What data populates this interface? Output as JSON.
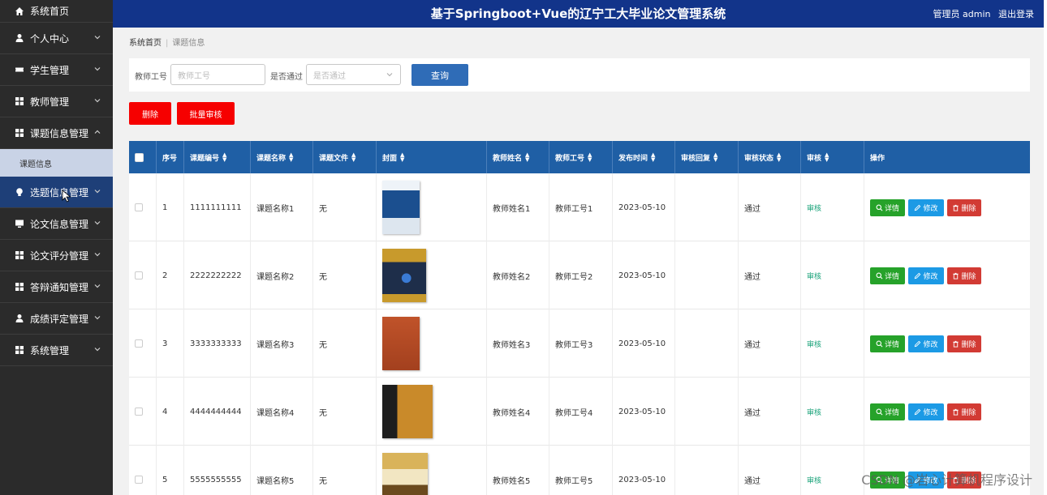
{
  "app": {
    "title": "基于Springboot+Vue的辽宁工大毕业论文管理系统",
    "user": "管理员 admin",
    "logout": "退出登录"
  },
  "sidebar": {
    "items": [
      {
        "label": "系统首页",
        "icon": "home-icon"
      },
      {
        "label": "个人中心",
        "icon": "user-icon"
      },
      {
        "label": "学生管理",
        "icon": "ticket-icon"
      },
      {
        "label": "教师管理",
        "icon": "grid-icon"
      },
      {
        "label": "课题信息管理",
        "icon": "grid-icon"
      },
      {
        "label": "选题信息管理",
        "icon": "bulb-icon"
      },
      {
        "label": "论文信息管理",
        "icon": "monitor-icon"
      },
      {
        "label": "论文评分管理",
        "icon": "grid-icon"
      },
      {
        "label": "答辩通知管理",
        "icon": "grid-icon"
      },
      {
        "label": "成绩评定管理",
        "icon": "user-icon"
      },
      {
        "label": "系统管理",
        "icon": "grid-icon"
      }
    ],
    "sub_item": "课题信息"
  },
  "breadcrumb": {
    "home": "系统首页",
    "current": "课题信息"
  },
  "search": {
    "teacher_no_label": "教师工号",
    "teacher_no_placeholder": "教师工号",
    "passed_label": "是否通过",
    "passed_placeholder": "是否通过",
    "query_button": "查询"
  },
  "actions": {
    "delete": "删除",
    "batch_audit": "批量审核"
  },
  "table": {
    "headers": [
      "序号",
      "课题编号",
      "课题名称",
      "课题文件",
      "封面",
      "教师姓名",
      "教师工号",
      "发布时间",
      "审核回复",
      "审核状态",
      "审核",
      "操作"
    ],
    "rows": [
      {
        "index": "1",
        "code": "1111111111",
        "name": "课题名称1",
        "file": "无",
        "teacher": "教师姓名1",
        "teacher_no": "教师工号1",
        "date": "2023-05-10",
        "reply": "",
        "status": "通过",
        "audit": "审核"
      },
      {
        "index": "2",
        "code": "2222222222",
        "name": "课题名称2",
        "file": "无",
        "teacher": "教师姓名2",
        "teacher_no": "教师工号2",
        "date": "2023-05-10",
        "reply": "",
        "status": "通过",
        "audit": "审核"
      },
      {
        "index": "3",
        "code": "3333333333",
        "name": "课题名称3",
        "file": "无",
        "teacher": "教师姓名3",
        "teacher_no": "教师工号3",
        "date": "2023-05-10",
        "reply": "",
        "status": "通过",
        "audit": "审核"
      },
      {
        "index": "4",
        "code": "4444444444",
        "name": "课题名称4",
        "file": "无",
        "teacher": "教师姓名4",
        "teacher_no": "教师工号4",
        "date": "2023-05-10",
        "reply": "",
        "status": "通过",
        "audit": "审核"
      },
      {
        "index": "5",
        "code": "5555555555",
        "name": "课题名称5",
        "file": "无",
        "teacher": "教师姓名5",
        "teacher_no": "教师工号5",
        "date": "2023-05-10",
        "reply": "",
        "status": "通过",
        "audit": "审核"
      }
    ],
    "op_labels": {
      "detail": "详情",
      "edit": "修改",
      "delete": "删除"
    }
  },
  "watermark": "CSDN @岩心计算机程序设计",
  "colors": {
    "topbar": "#12348a",
    "sidebar": "#2b2b2b",
    "table_header": "#1f5fa5",
    "danger": "#f60000",
    "success": "#26a22a",
    "info": "#1c9ae5"
  }
}
